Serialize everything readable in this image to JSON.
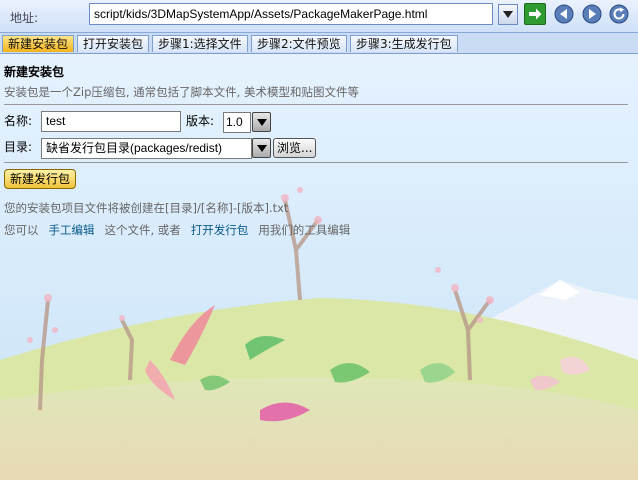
{
  "address": {
    "label": "地址:",
    "url": "script/kids/3DMapSystemApp/Assets/PackageMakerPage.html"
  },
  "tabs": [
    {
      "label": "新建安装包",
      "active": true
    },
    {
      "label": "打开安装包",
      "active": false
    },
    {
      "label": "步骤1:选择文件",
      "active": false
    },
    {
      "label": "步骤2:文件预览",
      "active": false
    },
    {
      "label": "步骤3:生成发行包",
      "active": false
    }
  ],
  "page": {
    "title": "新建安装包",
    "description": "安装包是一个Zip压缩包, 通常包括了脚本文件, 美术模型和贴图文件等"
  },
  "form": {
    "name_label": "名称:",
    "name_value": "test",
    "version_label": "版本:",
    "version_value": "1.0",
    "dir_label": "目录:",
    "dir_value": "缺省发行包目录(packages/redist)",
    "browse_label": "浏览...",
    "new_button": "新建发行包"
  },
  "info": {
    "path_note": "您的安装包项目文件将被创建在[目录]/[名称]-[版本].txt",
    "edit_prefix": "您可以",
    "manual_edit_link": "手工编辑",
    "edit_middle": "这个文件, 或者",
    "open_package_link": "打开发行包",
    "edit_suffix": "用我们的工具编辑"
  },
  "icons": {
    "go": "go-arrow-icon",
    "back": "back-icon",
    "forward": "forward-icon",
    "refresh": "refresh-icon"
  },
  "colors": {
    "active_tab": "#f3b31a",
    "link": "#0a5a8a",
    "go_button": "#2f9a2f"
  }
}
